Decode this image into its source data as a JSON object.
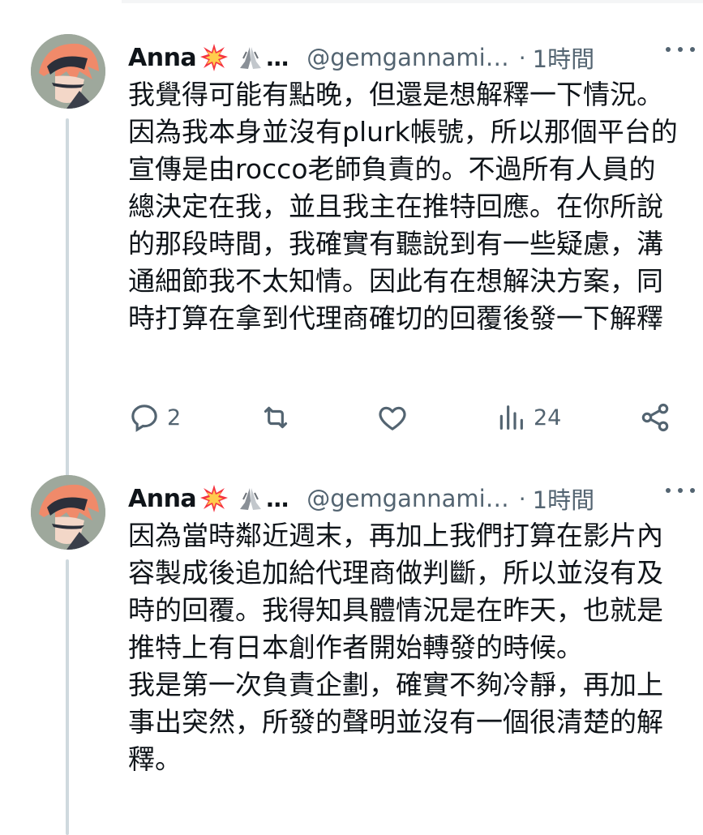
{
  "tweets": [
    {
      "name": "Anna",
      "name_ellipsis": "…",
      "handle": "@gemgannami…",
      "separator": "·",
      "time": "1時間",
      "body": "我覺得可能有點晚，但還是想解釋一下情況。因為我本身並沒有plurk帳號，所以那個平台的宣傳是由rocco老師負責的。不過所有人員的總決定在我，並且我主在推特回應。在你所說的那段時間，我確實有聽說到有一些疑慮，溝通細節我不太知情。因此有在想解決方案，同時打算在拿到代理商確切的回覆後發一下解釋",
      "replies": "2",
      "views": "24"
    },
    {
      "name": "Anna",
      "name_ellipsis": "…",
      "handle": "@gemgannami…",
      "separator": "·",
      "time": "1時間",
      "body": "因為當時鄰近週末，再加上我們打算在影片內容製成後追加給代理商做判斷，所以並沒有及時的回覆。我得知具體情況是在昨天，也就是推特上有日本創作者開始轉發的時候。\n我是第一次負責企劃，確實不夠冷靜，再加上事出突然，所發的聲明並沒有一個很清楚的解釋。"
    }
  ],
  "icons": {
    "reply": "reply-icon",
    "retweet": "retweet-icon",
    "like": "heart-icon",
    "views": "views-icon",
    "share": "share-icon",
    "more": "more-icon"
  },
  "colors": {
    "text": "#0f1419",
    "secondary": "#536471",
    "thread_line": "#cfd9de"
  }
}
